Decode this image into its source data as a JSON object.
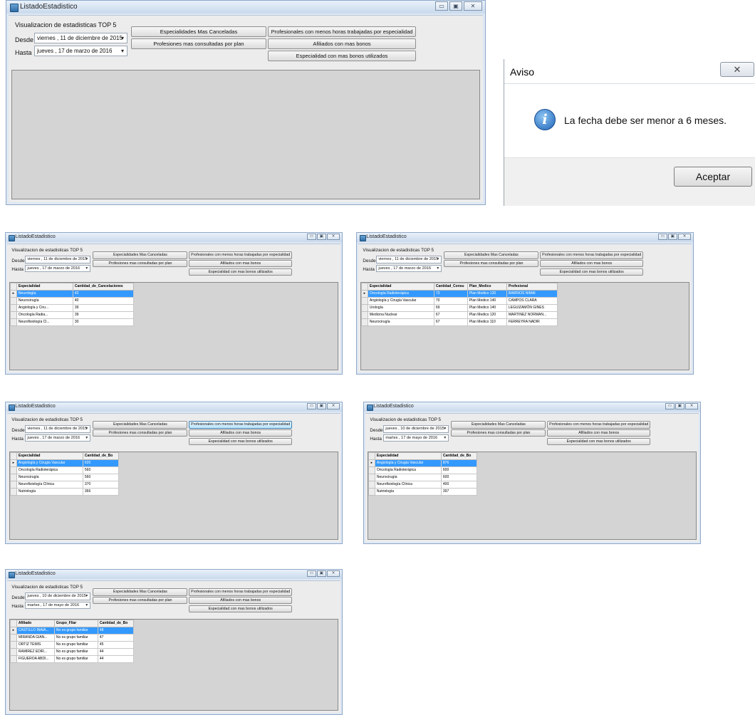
{
  "app": {
    "title": "ListadoEstadistico",
    "group_label": "Visualizacion de estadisticas TOP 5",
    "desde_label": "Desde",
    "hasta_label": "Hasta",
    "buttons": {
      "canceladas": "Especialidades  Mas Canceladas",
      "consultadas": "Profesiones mas consultadas por plan",
      "menos_horas": "Profesionales con menos horas trabajadas por especialidad",
      "afiliados": "Afiliados con mas bonos",
      "bonos": "Especialidad con mas bonos utilizados"
    },
    "controls": {
      "minimize": "▭",
      "maximize": "▣",
      "close": "✕"
    },
    "dropdown_arrow": "▾"
  },
  "windows": [
    {
      "desde": "viernes , 11 de diciembre de 2015",
      "hasta": "jueves  , 17 de   marzo   de 2016",
      "highlighted_button": "",
      "grid": null
    },
    {
      "desde": "viernes , 11 de diciembre de 2015",
      "hasta": "jueves  , 17 de   marzo   de 2016",
      "highlighted_button": "",
      "grid": {
        "columns": [
          "Especialidad",
          "Cantidad_de_Cancelaciones"
        ],
        "rows": [
          [
            "Neurología",
            "42"
          ],
          [
            "Neurocirugía",
            "40"
          ],
          [
            "Angiología y Ciru...",
            "39"
          ],
          [
            "Oncología Radia...",
            "39"
          ],
          [
            "Neurofisiología Cl...",
            "30"
          ]
        ]
      }
    },
    {
      "desde": "viernes , 11 de diciembre de 2015",
      "hasta": "jueves  , 17 de   marzo   de 2016",
      "highlighted_button": "",
      "grid": {
        "columns": [
          "Especialidad",
          "Cantidad_Consu",
          "Plan_Medico",
          "Profesional"
        ],
        "rows": [
          [
            "Oncología Radioterápica",
            "73",
            "Plan Medico 120",
            "BARRIOS NIMAI"
          ],
          [
            "Angiología y Cirugía Vascular",
            "70",
            "Plan Medico 140",
            "CAMPOS CLARA"
          ],
          [
            "Urología",
            "69",
            "Plan Medico 140",
            "LEGUIZAMÓN GINES"
          ],
          [
            "Medicina Nuclear",
            "67",
            "Plan Medico 120",
            "MARTINEZ NORMAN..."
          ],
          [
            "Neurocirugía",
            "67",
            "Plan Medico 110",
            "FERREYRA NADIR"
          ]
        ]
      }
    },
    {
      "desde": "viernes , 11 de diciembre de 2015",
      "hasta": "jueves  , 17 de   marzo   de 2016",
      "highlighted_button": "menos_horas",
      "grid": {
        "columns": [
          "Especialidad",
          "Cantidad_de_Bo"
        ],
        "rows": [
          [
            "Angiología y Cirugía Vascular",
            "620"
          ],
          [
            "Oncología Radioterápica",
            "560"
          ],
          [
            "Neurocirugía",
            "560"
          ],
          [
            "Neurofisiología Clínica",
            "370"
          ],
          [
            "Nutriología",
            "366"
          ]
        ]
      }
    },
    {
      "desde": "jueves  , 10 de diciembre de 2015",
      "hasta": "martes  , 17 de   mayo   de 2016",
      "highlighted_button": "",
      "grid": {
        "columns": [
          "Especialidad",
          "Cantidad_de_Bo"
        ],
        "rows": [
          [
            "Angiología y Cirugía Vascular",
            "876"
          ],
          [
            "Oncología Radioterápica",
            "600"
          ],
          [
            "Neurocirugía",
            "600"
          ],
          [
            "Neurofisiología Clínica",
            "400"
          ],
          [
            "Nutriología",
            "397"
          ]
        ]
      }
    },
    {
      "desde": "jueves  , 10 de diciembre de 2015",
      "hasta": "martes  , 17 de   mayo   de 2016",
      "highlighted_button": "",
      "grid": {
        "columns": [
          "Afiliado",
          "Grupo_Fliar",
          "Cantidad_de_Bo"
        ],
        "rows": [
          [
            "CASTILLO INAIA...",
            "No es grupo familiar",
            "48"
          ],
          [
            "MIRANDA GIAN...",
            "No es grupo familiar",
            "47"
          ],
          [
            "ORTIZ TEMIS",
            "No es grupo familiar",
            "45"
          ],
          [
            "RAMIREZ EDIR...",
            "No es grupo familiar",
            "44"
          ],
          [
            "FIGUEROA ABDI...",
            "No es grupo familiar",
            "44"
          ]
        ]
      }
    }
  ],
  "dialog": {
    "title": "Aviso",
    "message": "La fecha debe ser menor a 6 meses.",
    "ok": "Aceptar",
    "close": "✕",
    "icon": "info-icon",
    "icon_glyph": "i"
  }
}
